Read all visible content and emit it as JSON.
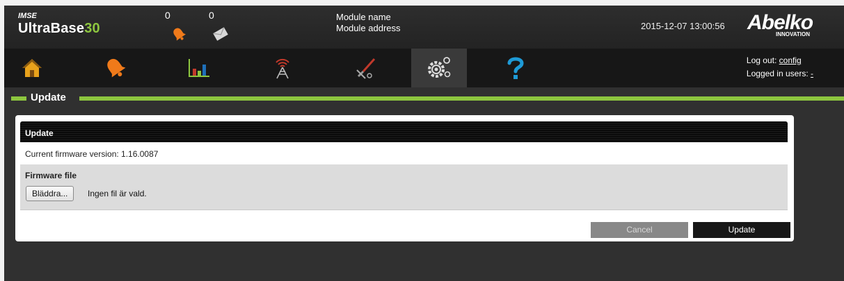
{
  "header": {
    "brand_small": "IMSE",
    "brand_main": "UltraBase",
    "brand_num": "30",
    "alarm_count": "0",
    "message_count": "0",
    "module_name": "Module name",
    "module_address": "Module address",
    "datetime": "2015-12-07 13:00:56",
    "logo_text": "Abelko",
    "logo_sub": "INNOVATION"
  },
  "nav": {
    "items": [
      {
        "icon": "home-icon"
      },
      {
        "icon": "alarm-bell-icon"
      },
      {
        "icon": "bar-chart-icon"
      },
      {
        "icon": "antenna-tower-icon"
      },
      {
        "icon": "tools-icon"
      },
      {
        "icon": "settings-gears-icon",
        "active": true
      },
      {
        "icon": "help-question-icon"
      }
    ],
    "logout_label": "Log out:",
    "logout_user": "config",
    "logged_in_label": "Logged in users:",
    "logged_in_users": "-"
  },
  "section": {
    "title": "Update"
  },
  "panel": {
    "header": "Update",
    "firmware_version_text": "Current firmware version: 1.16.0087",
    "firmware_file_label": "Firmware file",
    "browse_label": "Bläddra...",
    "no_file_text": "Ingen fil är vald.",
    "cancel_label": "Cancel",
    "update_label": "Update"
  },
  "colors": {
    "accent": "#8dc63f",
    "header_bg": "#2a2a2a",
    "nav_bg": "#171717",
    "panel_header_bg": "#0a0a0a",
    "bell": "#f07a1a",
    "help": "#1e9ad6"
  }
}
